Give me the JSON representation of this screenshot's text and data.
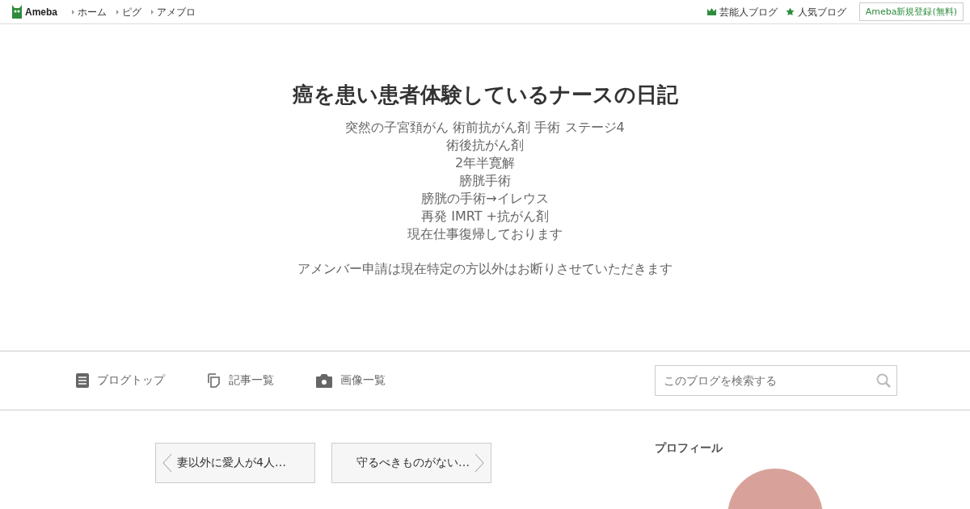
{
  "header": {
    "logo": "Ameba",
    "links": [
      "ホーム",
      "ピグ",
      "アメブロ"
    ],
    "right_links": [
      {
        "kind": "crown",
        "label": "芸能人ブログ"
      },
      {
        "kind": "star",
        "label": "人気ブログ"
      }
    ],
    "signup_button": "Ameba新規登録(無料)"
  },
  "blog": {
    "title": "癌を患い患者体験しているナースの日記",
    "description": [
      "突然の子宮頚がん 術前抗がん剤 手術 ステージ4",
      "術後抗がん剤",
      "2年半寛解",
      "膀胱手術",
      "膀胱の手術→イレウス",
      "再発 IMRT +抗がん剤",
      "現在仕事復帰しております"
    ],
    "note": "アメンバー申請は現在特定の方以外はお断りさせていただきます"
  },
  "nav": {
    "items": [
      {
        "kind": "document",
        "label": "ブログトップ"
      },
      {
        "kind": "copies",
        "label": "記事一覧"
      },
      {
        "kind": "camera",
        "label": "画像一覧"
      }
    ],
    "search": {
      "placeholder": "このブログを検索する"
    }
  },
  "pager": {
    "previous": "妻以外に愛人が4人…",
    "next": "守るべきものがない…"
  },
  "sidebar": {
    "heading": "プロフィール"
  }
}
